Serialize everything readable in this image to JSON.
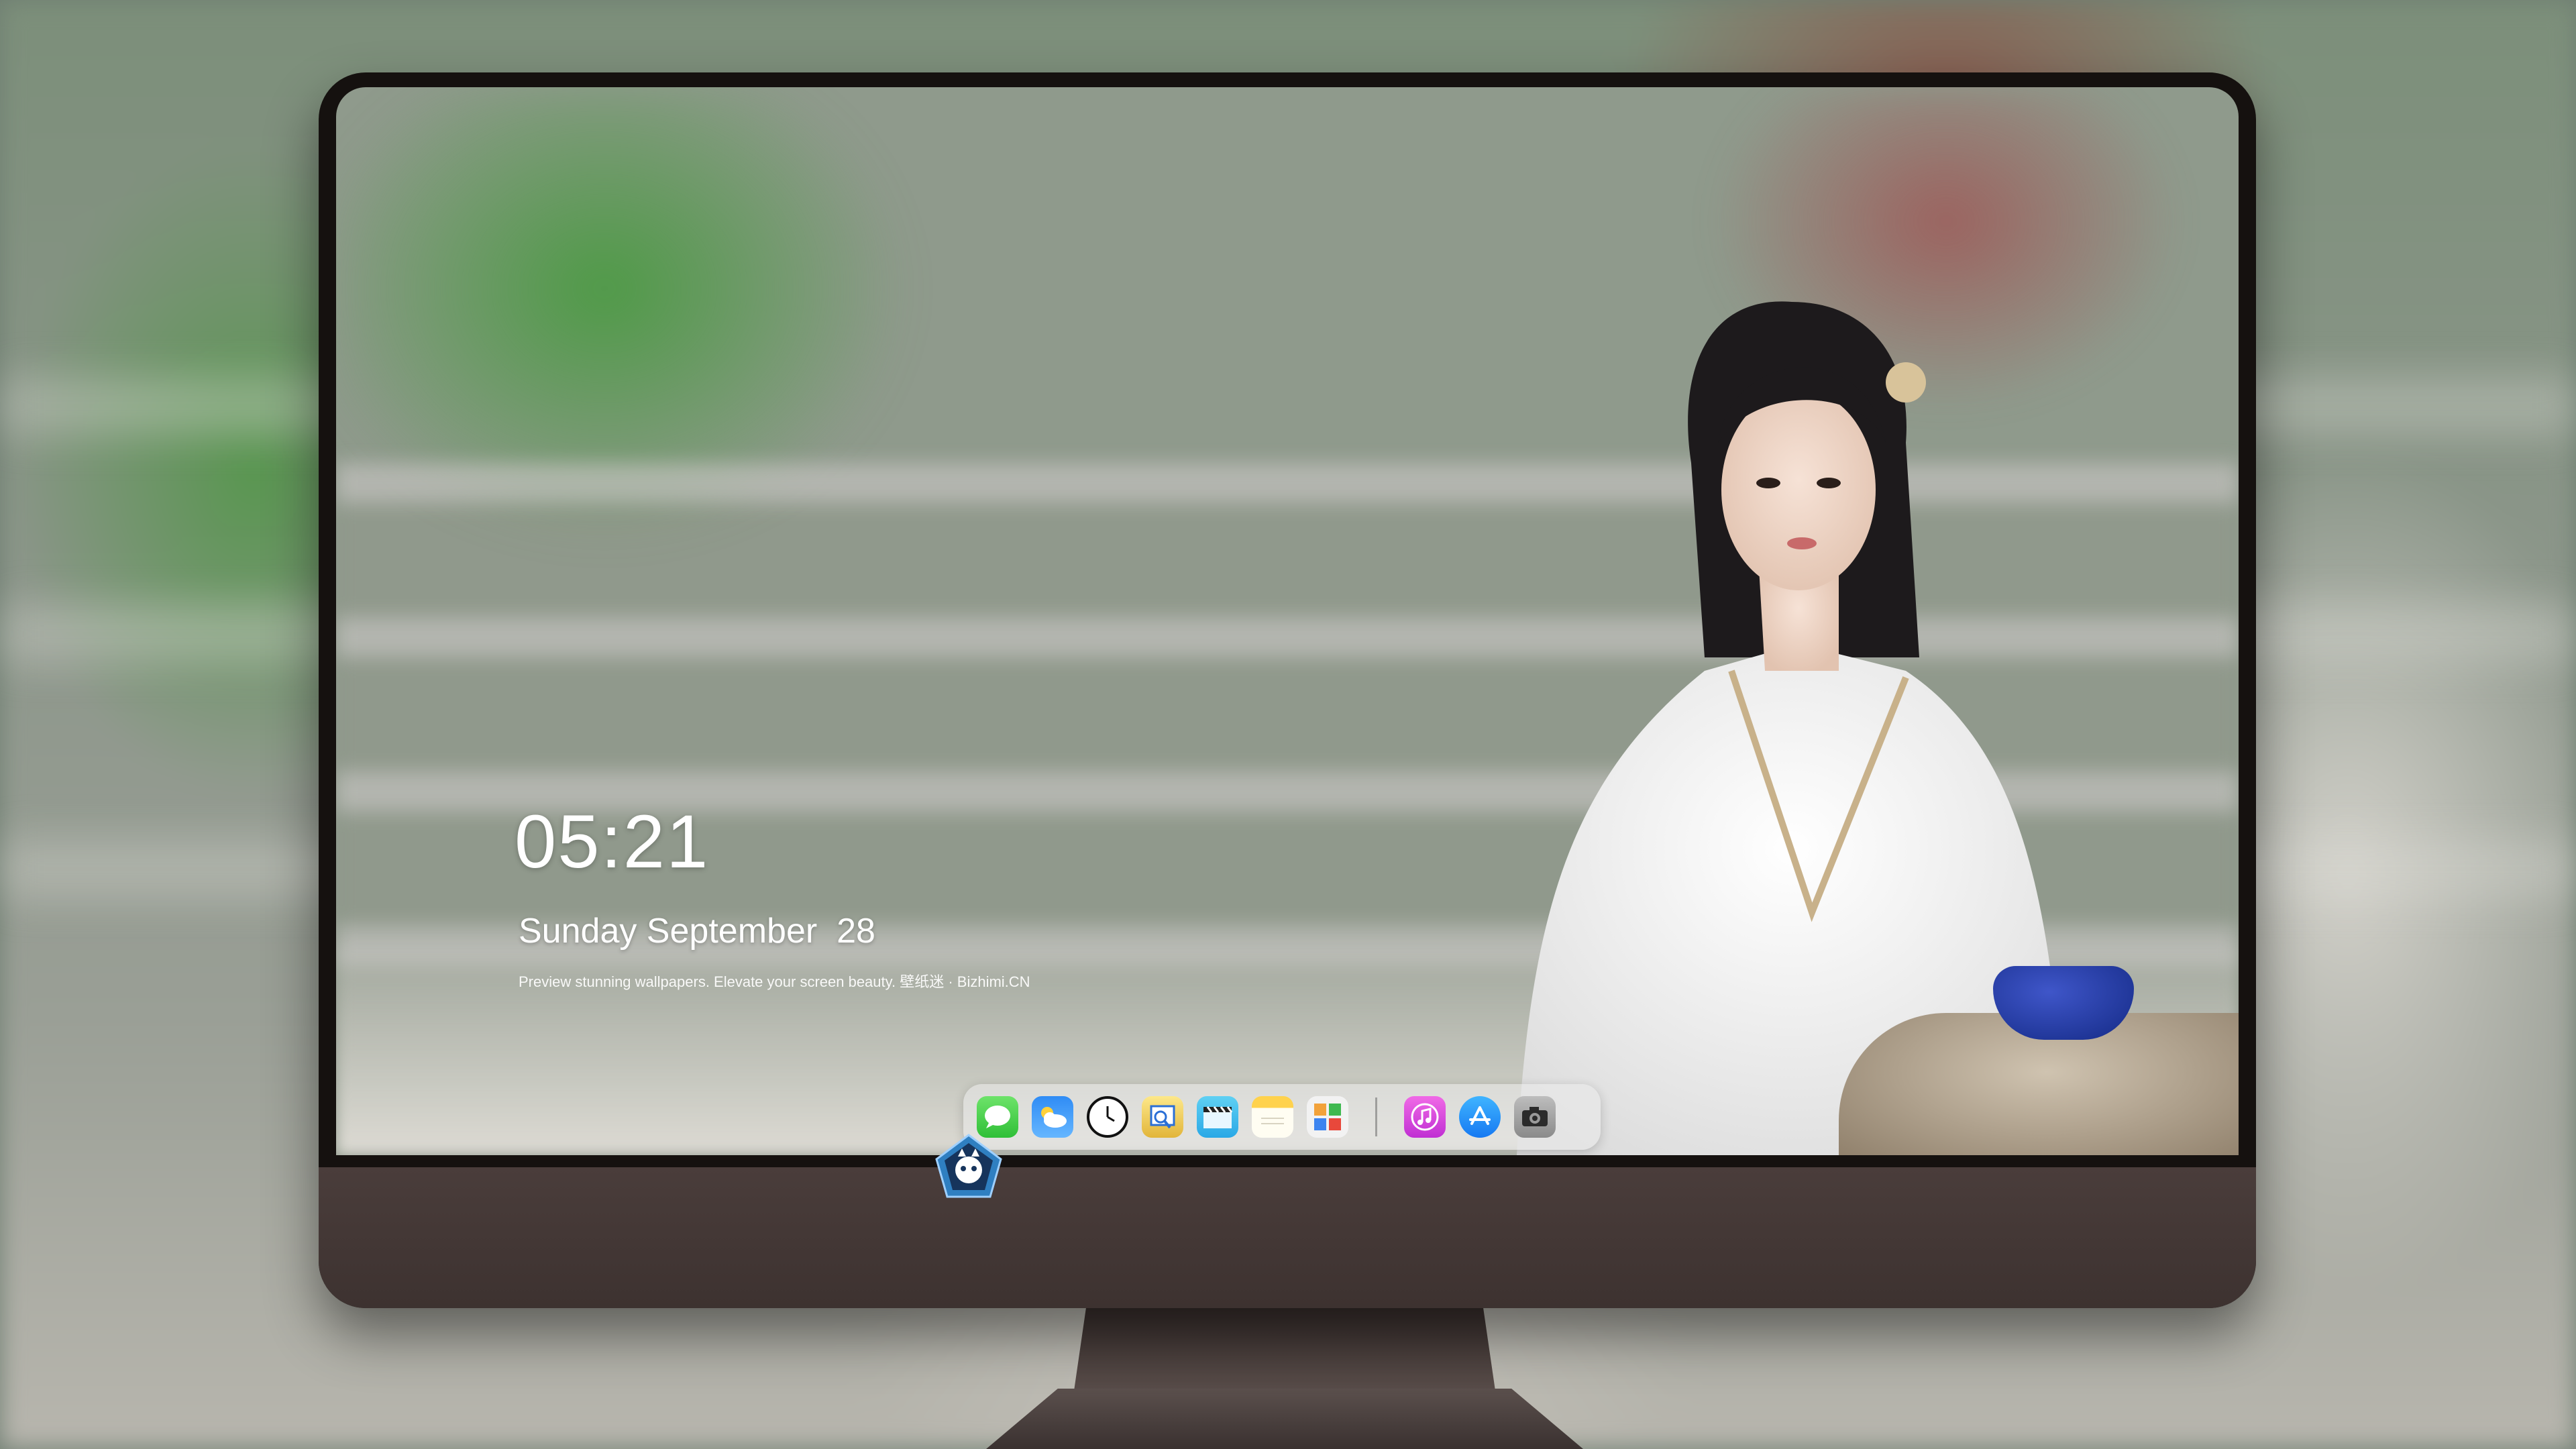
{
  "lockscreen": {
    "time": "05:21",
    "date": "Sunday September  28",
    "tagline": "Preview stunning wallpapers. Elevate your screen beauty. 壁纸迷 · Bizhimi.CN"
  },
  "dock": {
    "apps": [
      {
        "name": "Messages",
        "icon": "message-bubble-icon"
      },
      {
        "name": "Weather",
        "icon": "cloud-sun-icon"
      },
      {
        "name": "Clock",
        "icon": "clock-icon"
      },
      {
        "name": "Preview",
        "icon": "preview-icon"
      },
      {
        "name": "Clips",
        "icon": "clapperboard-icon"
      },
      {
        "name": "Notes",
        "icon": "notes-icon"
      },
      {
        "name": "Photo Booth",
        "icon": "photo-grid-icon"
      }
    ],
    "recent_apps": [
      {
        "name": "iTunes",
        "icon": "music-note-icon"
      },
      {
        "name": "App Store",
        "icon": "app-store-icon"
      },
      {
        "name": "Camera",
        "icon": "camera-icon"
      }
    ]
  },
  "colors": {
    "monitor_bezel": "#15110f",
    "monitor_chin": "#4a3d3b",
    "dock_background": "#ebebeb",
    "clock_text": "#ffffff"
  }
}
